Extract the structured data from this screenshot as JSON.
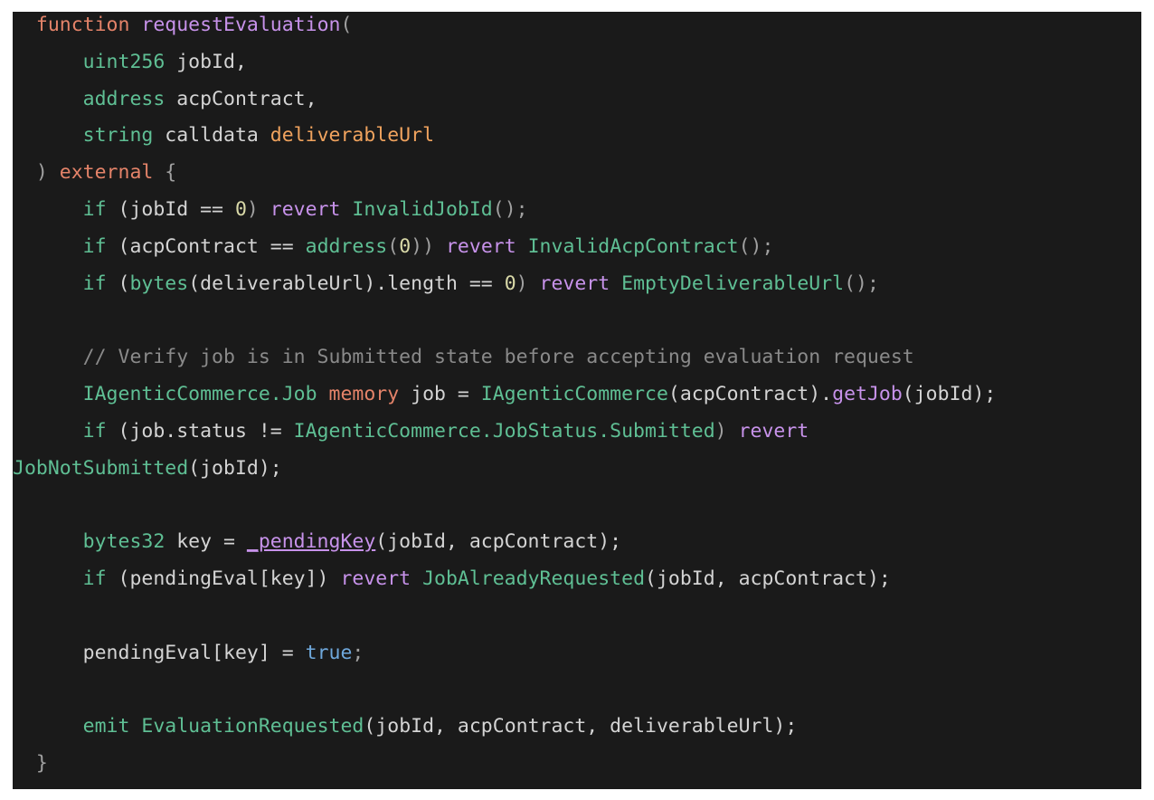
{
  "colors": {
    "background": "#1a1a1a",
    "keyword": "#e48369",
    "function_name": "#c792ea",
    "type": "#5fbf94",
    "identifier": "#d4d4d4",
    "punctuation": "#a0a0a0",
    "number": "#d9d9a8",
    "parameter": "#f0a35e",
    "comment": "#8a8a8a",
    "boolean": "#6fa8dc"
  },
  "code": {
    "lines": [
      {
        "indent": "  ",
        "tokens": [
          {
            "t": "function",
            "c": "kw"
          },
          {
            "t": " ",
            "c": "tx"
          },
          {
            "t": "requestEvaluation",
            "c": "fn"
          },
          {
            "t": "(",
            "c": "pn"
          }
        ]
      },
      {
        "indent": "      ",
        "tokens": [
          {
            "t": "uint256",
            "c": "ty"
          },
          {
            "t": " jobId,",
            "c": "tx"
          }
        ]
      },
      {
        "indent": "      ",
        "tokens": [
          {
            "t": "address",
            "c": "ty"
          },
          {
            "t": " acpContract,",
            "c": "tx"
          }
        ]
      },
      {
        "indent": "      ",
        "tokens": [
          {
            "t": "string",
            "c": "ty"
          },
          {
            "t": " calldata ",
            "c": "tx"
          },
          {
            "t": "deliverableUrl",
            "c": "pr"
          }
        ]
      },
      {
        "indent": "  ",
        "tokens": [
          {
            "t": ") ",
            "c": "pn"
          },
          {
            "t": "external",
            "c": "kw"
          },
          {
            "t": " {",
            "c": "pn"
          }
        ]
      },
      {
        "indent": "      ",
        "tokens": [
          {
            "t": "if",
            "c": "ty"
          },
          {
            "t": " (jobId == ",
            "c": "tx"
          },
          {
            "t": "0",
            "c": "nm"
          },
          {
            "t": ") ",
            "c": "pn"
          },
          {
            "t": "revert",
            "c": "fn"
          },
          {
            "t": " ",
            "c": "tx"
          },
          {
            "t": "InvalidJobId",
            "c": "ty"
          },
          {
            "t": "();",
            "c": "pn"
          }
        ]
      },
      {
        "indent": "      ",
        "tokens": [
          {
            "t": "if",
            "c": "ty"
          },
          {
            "t": " (acpContract == ",
            "c": "tx"
          },
          {
            "t": "address",
            "c": "ty"
          },
          {
            "t": "(",
            "c": "pn"
          },
          {
            "t": "0",
            "c": "nm"
          },
          {
            "t": ")) ",
            "c": "pn"
          },
          {
            "t": "revert",
            "c": "fn"
          },
          {
            "t": " ",
            "c": "tx"
          },
          {
            "t": "InvalidAcpContract",
            "c": "ty"
          },
          {
            "t": "();",
            "c": "pn"
          }
        ]
      },
      {
        "indent": "      ",
        "tokens": [
          {
            "t": "if",
            "c": "ty"
          },
          {
            "t": " (",
            "c": "tx"
          },
          {
            "t": "bytes",
            "c": "ty"
          },
          {
            "t": "(deliverableUrl).length == ",
            "c": "tx"
          },
          {
            "t": "0",
            "c": "nm"
          },
          {
            "t": ") ",
            "c": "pn"
          },
          {
            "t": "revert",
            "c": "fn"
          },
          {
            "t": " ",
            "c": "tx"
          },
          {
            "t": "EmptyDeliverableUrl",
            "c": "ty"
          },
          {
            "t": "();",
            "c": "pn"
          }
        ]
      },
      {
        "indent": "",
        "tokens": []
      },
      {
        "indent": "      ",
        "tokens": [
          {
            "t": "// Verify job is in Submitted state before accepting evaluation request",
            "c": "cm"
          }
        ]
      },
      {
        "indent": "      ",
        "tokens": [
          {
            "t": "IAgenticCommerce.Job",
            "c": "ty"
          },
          {
            "t": " ",
            "c": "tx"
          },
          {
            "t": "memory",
            "c": "kw"
          },
          {
            "t": " job = ",
            "c": "tx"
          },
          {
            "t": "IAgenticCommerce",
            "c": "ty"
          },
          {
            "t": "(acpContract).",
            "c": "tx"
          },
          {
            "t": "getJob",
            "c": "fn"
          },
          {
            "t": "(jobId);",
            "c": "tx"
          }
        ]
      },
      {
        "indent": "      ",
        "tokens": [
          {
            "t": "if",
            "c": "ty"
          },
          {
            "t": " (job.status != ",
            "c": "tx"
          },
          {
            "t": "IAgenticCommerce.JobStatus.Submitted",
            "c": "ty"
          },
          {
            "t": ") ",
            "c": "pn"
          },
          {
            "t": "revert",
            "c": "fn"
          }
        ]
      },
      {
        "indent": "",
        "tokens": [
          {
            "t": "JobNotSubmitted",
            "c": "ty"
          },
          {
            "t": "(jobId);",
            "c": "tx"
          }
        ]
      },
      {
        "indent": "",
        "tokens": []
      },
      {
        "indent": "      ",
        "tokens": [
          {
            "t": "bytes32",
            "c": "ty"
          },
          {
            "t": " key = ",
            "c": "tx"
          },
          {
            "t": "_pendingKey",
            "c": "fn"
          },
          {
            "t": "(jobId, acpContract);",
            "c": "tx"
          }
        ]
      },
      {
        "indent": "      ",
        "tokens": [
          {
            "t": "if",
            "c": "ty"
          },
          {
            "t": " (pendingEval[key]) ",
            "c": "tx"
          },
          {
            "t": "revert",
            "c": "fn"
          },
          {
            "t": " ",
            "c": "tx"
          },
          {
            "t": "JobAlreadyRequested",
            "c": "ty"
          },
          {
            "t": "(jobId, acpContract);",
            "c": "tx"
          }
        ]
      },
      {
        "indent": "",
        "tokens": []
      },
      {
        "indent": "      ",
        "tokens": [
          {
            "t": "pendingEval[key] = ",
            "c": "tx"
          },
          {
            "t": "true",
            "c": "bo"
          },
          {
            "t": ";",
            "c": "pn"
          }
        ]
      },
      {
        "indent": "",
        "tokens": []
      },
      {
        "indent": "      ",
        "tokens": [
          {
            "t": "emit",
            "c": "ty"
          },
          {
            "t": " ",
            "c": "tx"
          },
          {
            "t": "EvaluationRequested",
            "c": "ty"
          },
          {
            "t": "(jobId, acpContract, deliverableUrl);",
            "c": "tx"
          }
        ]
      },
      {
        "indent": "  ",
        "tokens": [
          {
            "t": "}",
            "c": "pn"
          }
        ]
      }
    ]
  }
}
